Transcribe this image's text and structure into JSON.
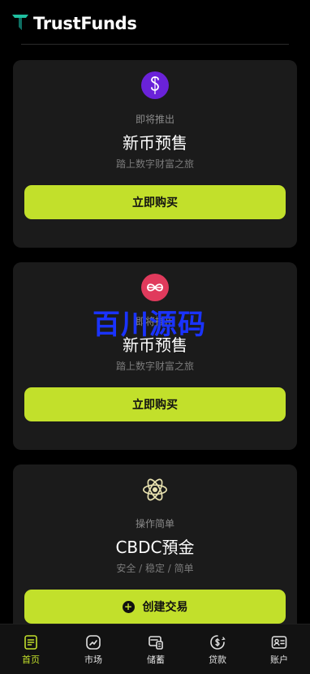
{
  "header": {
    "brand": "TrustFunds",
    "logo_icon": "trustfunds-logo-icon"
  },
  "cards": [
    {
      "coin_icon": "purple-s-coin-icon",
      "coin_color": "#6a22d9",
      "eyebrow": "即将推出",
      "title": "新币预售",
      "subtitle": "踏上数字财富之旅",
      "button": "立即购买"
    },
    {
      "coin_icon": "red-infinity-coin-icon",
      "coin_color": "#e03a5c",
      "eyebrow": "即将推出",
      "title": "新币预售",
      "subtitle": "踏上数字财富之旅",
      "button": "立即购买"
    },
    {
      "coin_icon": "atom-icon",
      "eyebrow": "操作简单",
      "title": "CBDC預金",
      "subtitle": "安全 / 稳定 / 简单",
      "button": "创建交易",
      "button_icon": "plus-circle-icon"
    }
  ],
  "watermark": "百川源码",
  "tabs": [
    {
      "label": "首页",
      "icon": "home-icon",
      "active": true
    },
    {
      "label": "市场",
      "icon": "market-trend-icon"
    },
    {
      "label": "储蓄",
      "icon": "savings-icon"
    },
    {
      "label": "贷款",
      "icon": "loan-dollar-icon"
    },
    {
      "label": "账户",
      "icon": "account-card-icon"
    }
  ],
  "colors": {
    "accent": "#c2e02b",
    "card_bg": "#1b1b1b",
    "page_bg": "#000000"
  }
}
